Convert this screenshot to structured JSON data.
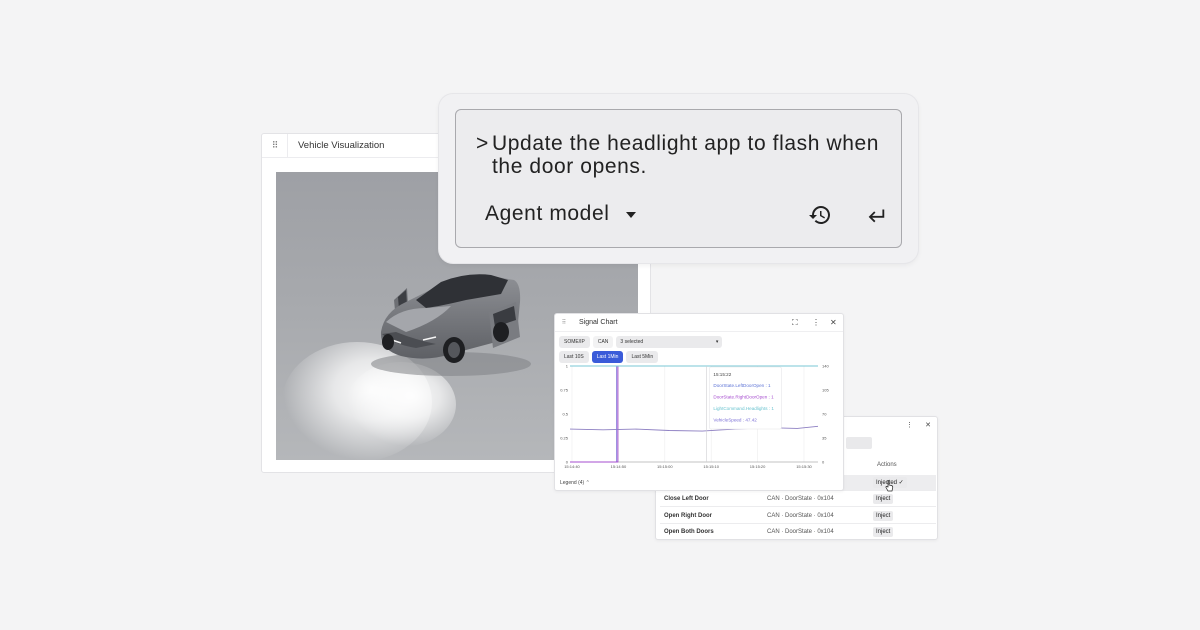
{
  "viz": {
    "title": "Vehicle Visualization",
    "drag_glyph": "⠿"
  },
  "prompt": {
    "caret": ">",
    "text": "Update the headlight app to flash when the door opens.",
    "model_label": "Agent model",
    "history_icon": "history-icon",
    "enter_icon": "enter-icon"
  },
  "signal_chart": {
    "title": "Signal Chart",
    "drag_glyph": "⠿",
    "protocols": [
      "SOME/IP",
      "CAN"
    ],
    "signal_select": "3 selected",
    "ranges": [
      "Last 10S",
      "Last 1Min",
      "Last 5Min"
    ],
    "active_range": "Last 1Min",
    "legend_label": "Legend (4)  ⌃",
    "icons": {
      "expand": "⛶",
      "more": "⋮",
      "close": "✕"
    }
  },
  "chart_data": {
    "type": "line",
    "x_ticks": [
      "15:14:40",
      "15:14:50",
      "15:15:00",
      "15:15:10",
      "15:15:20",
      "15:15:30"
    ],
    "y_left_ticks": [
      "0",
      "0.25",
      "0.5",
      "0.75",
      "1"
    ],
    "y_right_ticks": [
      "0",
      "35",
      "70",
      "105",
      "140"
    ],
    "ylim_left": [
      0,
      1
    ],
    "ylim_right": [
      0,
      140
    ],
    "series": [
      {
        "name": "DoorState.LeftDoorOpen",
        "axis": "left",
        "color": "#7b6fd6",
        "x": [
          0,
          11.3,
          11.3,
          60
        ],
        "y": [
          0,
          0,
          1,
          1
        ]
      },
      {
        "name": "DoorState.RightDoorOpen",
        "axis": "left",
        "color": "#a64ccf",
        "x": [
          0,
          11.6,
          11.6,
          60
        ],
        "y": [
          0,
          0,
          1,
          1
        ]
      },
      {
        "name": "LightCommand.Headlights",
        "axis": "left",
        "color": "#79c7d4",
        "x": [
          0,
          60
        ],
        "y": [
          1,
          1
        ]
      },
      {
        "name": "VehicleSpeed",
        "axis": "right",
        "color": "#8d7fc2",
        "x": [
          0,
          8,
          16,
          24,
          32,
          40,
          48,
          55,
          60
        ],
        "y": [
          48,
          47,
          48,
          46,
          45,
          48,
          50,
          49,
          52
        ]
      }
    ],
    "cursor_x": 33,
    "tooltip": {
      "time": "15:15:22",
      "rows": [
        {
          "label": "DoorState.LeftDoorOpen : 1",
          "color": "#5d73d6"
        },
        {
          "label": "DoorState.RightDoorOpen : 1",
          "color": "#a64ccf"
        },
        {
          "label": "LightCommand.Headlights : 1",
          "color": "#69c3cf"
        },
        {
          "label": "VehicleSpeed : 47.42",
          "color": "#7b6fd6"
        }
      ]
    },
    "title": "",
    "xlabel": "",
    "ylabel": "",
    "grid": true
  },
  "actions_table": {
    "header_actions": "Actions",
    "icons": {
      "more": "⋮",
      "close": "✕"
    },
    "rows": [
      {
        "name": "",
        "signal": "",
        "action": "Injected ✓",
        "highlight": true
      },
      {
        "name": "Close Left Door",
        "signal": "CAN · DoorState · 0x104",
        "action": "Inject"
      },
      {
        "name": "Open Right Door",
        "signal": "CAN · DoorState · 0x104",
        "action": "Inject"
      },
      {
        "name": "Open Both Doors",
        "signal": "CAN · DoorState · 0x104",
        "action": "Inject"
      }
    ]
  }
}
